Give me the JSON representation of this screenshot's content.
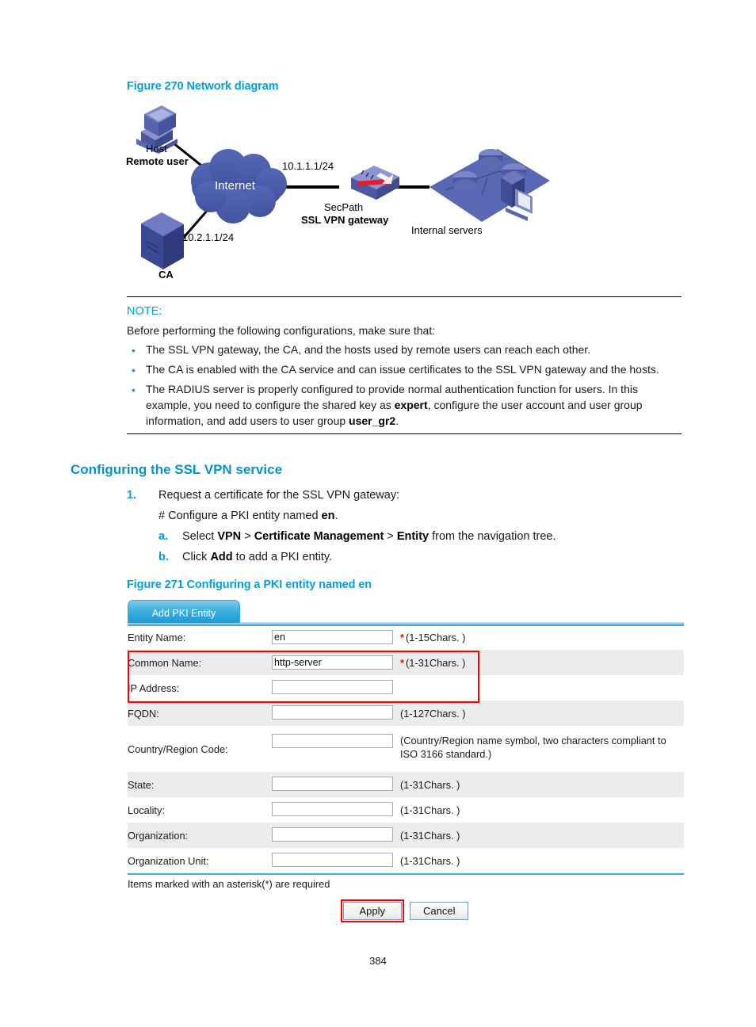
{
  "figure270": {
    "caption": "Figure 270 Network diagram",
    "labels": {
      "host": "Host",
      "remote_user": "Remote user",
      "internet": "Internet",
      "gateway_ip": "10.1.1.1/24",
      "ca_ip": "10.2.1.1/24",
      "secpath": "SecPath",
      "ssl_vpn_gateway": "SSL VPN gateway",
      "internal_servers": "Internal servers",
      "ca": "CA"
    }
  },
  "note": {
    "title": "NOTE:",
    "intro": "Before performing the following configurations, make sure that:",
    "items": [
      "The SSL VPN gateway, the CA, and the hosts used by remote users can reach each other.",
      "The CA is enabled with the CA service and can issue certificates to the SSL VPN gateway and the hosts.",
      "The RADIUS server is properly configured to provide normal authentication function for users. In this example, you need to configure the shared key as |expert|, configure the user account and user group information, and add users to user group |user_gr2|."
    ]
  },
  "section": {
    "heading": "Configuring the SSL VPN service",
    "step1_num": "1.",
    "step1_text": "Request a certificate for the SSL VPN gateway:",
    "step1_comment": "# Configure a PKI entity named |en|.",
    "sub_a_num": "a.",
    "sub_a_text": "Select |VPN| > |Certificate Management| > |Entity| from the navigation tree.",
    "sub_b_num": "b.",
    "sub_b_text": "Click |Add| to add a PKI entity."
  },
  "figure271": {
    "caption": "Figure 271 Configuring a PKI entity named en"
  },
  "pki_form": {
    "tab_label": "Add PKI Entity",
    "rows": [
      {
        "label": "Entity Name:",
        "value": "en",
        "required": "*",
        "hint": "(1-15Chars. )"
      },
      {
        "label": "Common Name:",
        "value": "http-server",
        "required": "*",
        "hint": "(1-31Chars. )"
      },
      {
        "label": "IP Address:",
        "value": "",
        "required": "",
        "hint": ""
      },
      {
        "label": "FQDN:",
        "value": "",
        "required": "",
        "hint": "(1-127Chars. )"
      },
      {
        "label": "Country/Region Code:",
        "value": "",
        "required": "",
        "hint": "(Country/Region name symbol, two characters compliant to ISO 3166 standard.)"
      },
      {
        "label": "State:",
        "value": "",
        "required": "",
        "hint": "(1-31Chars. )"
      },
      {
        "label": "Locality:",
        "value": "",
        "required": "",
        "hint": "(1-31Chars. )"
      },
      {
        "label": "Organization:",
        "value": "",
        "required": "",
        "hint": "(1-31Chars. )"
      },
      {
        "label": "Organization Unit:",
        "value": "",
        "required": "",
        "hint": "(1-31Chars. )"
      }
    ],
    "asterisk_note": "Items marked with an asterisk(*) are required",
    "apply_label": "Apply",
    "cancel_label": "Cancel"
  },
  "page_number": "384",
  "colors": {
    "accent_blue": "#00a0df",
    "heading_blue": "#0096d6",
    "required_red": "#ff0000",
    "row_alt": "#ececec",
    "node_blue": "#5a68b4",
    "cloud_blue": "#4a5cb0"
  }
}
